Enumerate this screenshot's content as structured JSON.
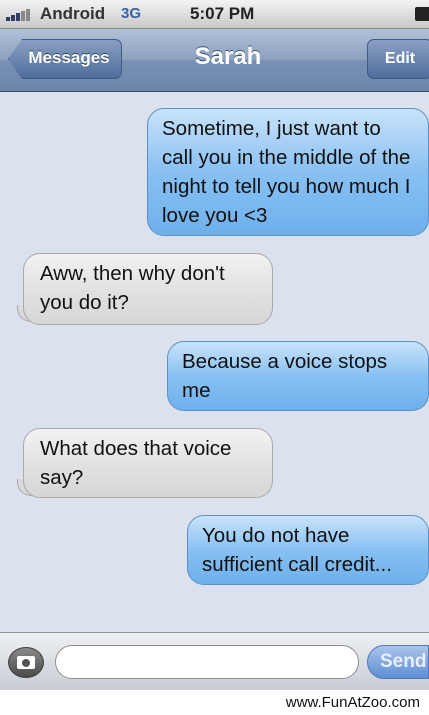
{
  "status_bar": {
    "carrier": "Android",
    "network": "3G",
    "time": "5:07 PM"
  },
  "nav": {
    "back_label": "Messages",
    "title": "Sarah",
    "edit_label": "Edit"
  },
  "messages": [
    {
      "sender": "me",
      "text": "Sometime, I just want to call you in the middle of the night to tell you how much I love you <3"
    },
    {
      "sender": "Sarah",
      "text": "Aww, then why don't you do it?"
    },
    {
      "sender": "me",
      "text": "Because a voice stops me"
    },
    {
      "sender": "Sarah",
      "text": "What does that voice say?"
    },
    {
      "sender": "me",
      "text": "You do not have sufficient call credit..."
    }
  ],
  "composer": {
    "placeholder": "",
    "send_label": "Send"
  },
  "watermark": "www.FunAtZoo.com",
  "colors": {
    "outgoing_bubble": "#88c0f2",
    "incoming_bubble": "#e2e2e2",
    "background": "#dbe2ed",
    "nav_bar": "#7890b3"
  }
}
